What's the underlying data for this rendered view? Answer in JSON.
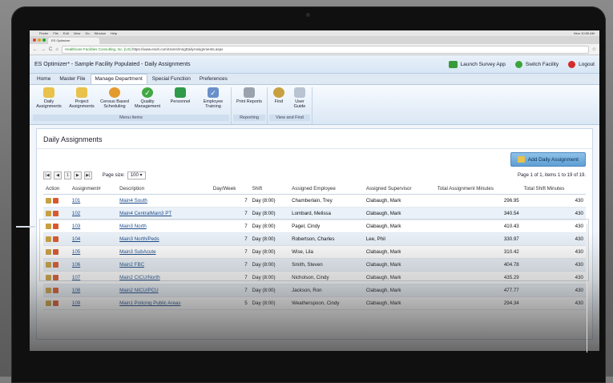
{
  "os_menubar": {
    "items": [
      "Finder",
      "File",
      "Edit",
      "View",
      "Go",
      "Window",
      "Help"
    ],
    "right": "Mon 10:55 AM"
  },
  "browser": {
    "tab_title": "ES Optimizer",
    "url_secure": "Healthcare Facilities Consulting, Inc. [US]",
    "url": "https://www.esoh.com/Users/mngDailyAssignments.aspx"
  },
  "app": {
    "title": "ES Optimizer* - Sample Facility Populated - Daily Assignments",
    "actions": {
      "launch": "Launch Survey App",
      "switch": "Switch Facility",
      "logout": "Logout"
    }
  },
  "menu_tabs": [
    "Home",
    "Master File",
    "Manage Department",
    "Special Function",
    "Preferences"
  ],
  "ribbon": {
    "menu_items": {
      "label": "Menu Items",
      "items": [
        "Daily Assignments",
        "Project Assignments",
        "Census Based Scheduling",
        "Quality Management",
        "Personnel",
        "Employee Training"
      ]
    },
    "reporting": {
      "label": "Reporting",
      "items": [
        "Print Reports"
      ]
    },
    "view_find": {
      "label": "View and Find",
      "items": [
        "Find",
        "User Guide"
      ]
    }
  },
  "page": {
    "title": "Daily Assignments",
    "add_button": "Add Daily Assignment",
    "pager": {
      "page": "1",
      "page_size_label": "Page size:",
      "page_size": "100",
      "info": "Page 1 of 1, items 1 to 19 of 19."
    }
  },
  "table": {
    "headers": [
      "Action",
      "Assignment#",
      "Description",
      "Day/Week",
      "Shift",
      "Assigned Employee",
      "Assigned Supervisor",
      "Total Assignment Minutes",
      "Total Shift Minutes"
    ],
    "rows": [
      [
        "101",
        "Main4 South",
        "7",
        "Day (8:00)",
        "Chamberlain, Trey",
        "Clabaugh, Mark",
        "296.95",
        "430"
      ],
      [
        "102",
        "Main4 CentralMain3 PT",
        "7",
        "Day (8:00)",
        "Lombard, Melissa",
        "Clabaugh, Mark",
        "340.54",
        "430"
      ],
      [
        "103",
        "Main3 North",
        "7",
        "Day (8:00)",
        "Pagel, Cindy",
        "Clabaugh, Mark",
        "410.43",
        "430"
      ],
      [
        "104",
        "Main3 North/Peds",
        "7",
        "Day (8:00)",
        "Robertson, Charles",
        "Lee, Phil",
        "330.97",
        "430"
      ],
      [
        "105",
        "Main3 SubAcute",
        "7",
        "Day (8:00)",
        "Wise, Lila",
        "Clabaugh, Mark",
        "310.42",
        "430"
      ],
      [
        "106",
        "Main2 FBC",
        "7",
        "Day (8:00)",
        "Smith, Steven",
        "Clabaugh, Mark",
        "404.78",
        "430"
      ],
      [
        "107",
        "Main2 CICU/North",
        "7",
        "Day (8:00)",
        "Nicholson, Cindy",
        "Clabaugh, Mark",
        "435.29",
        "430"
      ],
      [
        "108",
        "Main2 NICU/PCU",
        "7",
        "Day (8:00)",
        "Jackson, Ron",
        "Clabaugh, Mark",
        "477.77",
        "430"
      ],
      [
        "109",
        "Main1 Policing Public Areas",
        "5",
        "Day (8:00)",
        "Weatherspoon, Cindy",
        "Clabaugh, Mark",
        "294.34",
        "430"
      ]
    ]
  },
  "colors": {
    "accent": "#5d9fd4",
    "link": "#1a4a8a",
    "header_bg": "#d7e6f4"
  }
}
